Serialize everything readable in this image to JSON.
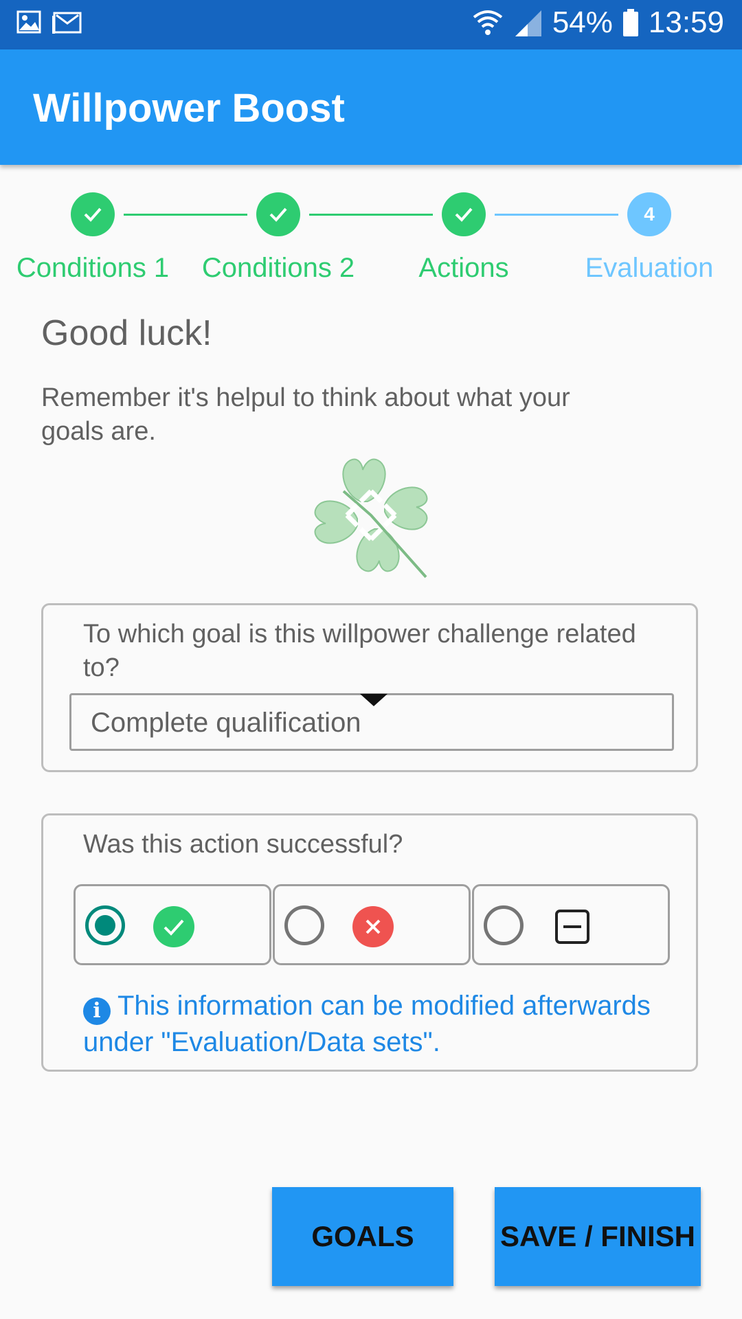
{
  "status_bar": {
    "battery": "54%",
    "time": "13:59",
    "icons": [
      "image-icon",
      "gmail-icon",
      "wifi-icon",
      "signal-icon",
      "battery-icon"
    ]
  },
  "app_bar": {
    "title": "Willpower Boost"
  },
  "stepper": {
    "steps": [
      {
        "label": "Conditions 1",
        "state": "done"
      },
      {
        "label": "Conditions 2",
        "state": "done"
      },
      {
        "label": "Actions",
        "state": "done"
      },
      {
        "label": "Evaluation",
        "state": "current",
        "number": "4"
      }
    ],
    "colors": {
      "done": "#2ecc71",
      "current": "#6ec6ff"
    }
  },
  "content": {
    "heading": "Good luck!",
    "intro": "Remember it's helpul to think about what your goals are.",
    "image": "clover-icon"
  },
  "goal_card": {
    "question": "To which goal is this willpower challenge related to?",
    "selected_goal": "Complete qualification"
  },
  "success_card": {
    "question": "Was this action successful?",
    "options": [
      {
        "name": "success",
        "icon": "check-icon",
        "selected": true
      },
      {
        "name": "failure",
        "icon": "close-icon",
        "selected": false
      },
      {
        "name": "neutral",
        "icon": "minus-box-icon",
        "selected": false
      }
    ],
    "info_text": "This information can be modified afterwards under \"Evaluation/Data sets\"."
  },
  "buttons": {
    "goals": "GOALS",
    "save_finish": "SAVE / FINISH"
  },
  "colors": {
    "status_bar": "#1565c0",
    "app_bar": "#2196f3",
    "accent": "#00897b",
    "info": "#1e88e5"
  }
}
